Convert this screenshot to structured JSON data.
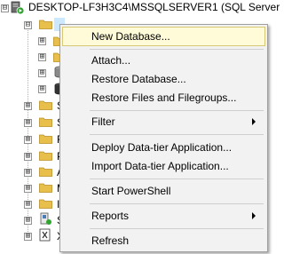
{
  "object_explorer": {
    "server_label": "DESKTOP-LF3H3C4\\MSSQLSERVER1 (SQL Server",
    "expanded_symbol": "⊟",
    "collapsed_symbol": "⊞",
    "colors": {
      "folder": "#e8bf4a",
      "selection": "#cce8ff",
      "server_status": "#2fa52f"
    },
    "children": [
      {
        "icon": "folder-icon",
        "text": ""
      },
      {
        "icon": "folder-icon",
        "text": ""
      },
      {
        "icon": "database-icon",
        "text": ""
      },
      {
        "icon": "database-icon",
        "text": ""
      },
      {
        "icon": "folder-icon",
        "text": "S"
      },
      {
        "icon": "folder-icon",
        "text": "S"
      },
      {
        "icon": "folder-icon",
        "text": "R"
      },
      {
        "icon": "folder-icon",
        "text": "P"
      },
      {
        "icon": "folder-icon",
        "text": "A"
      },
      {
        "icon": "folder-icon",
        "text": "M"
      },
      {
        "icon": "folder-icon",
        "text": "I"
      },
      {
        "icon": "agent-icon",
        "text": "S"
      },
      {
        "icon": "xevent-icon",
        "text": "X"
      }
    ]
  },
  "context_menu": {
    "new_database": "New Database...",
    "attach": "Attach...",
    "restore_database": "Restore Database...",
    "restore_files": "Restore Files and Filegroups...",
    "filter": "Filter",
    "deploy_data_tier": "Deploy Data-tier Application...",
    "import_data_tier": "Import Data-tier Application...",
    "start_powershell": "Start PowerShell",
    "reports": "Reports",
    "refresh": "Refresh"
  }
}
